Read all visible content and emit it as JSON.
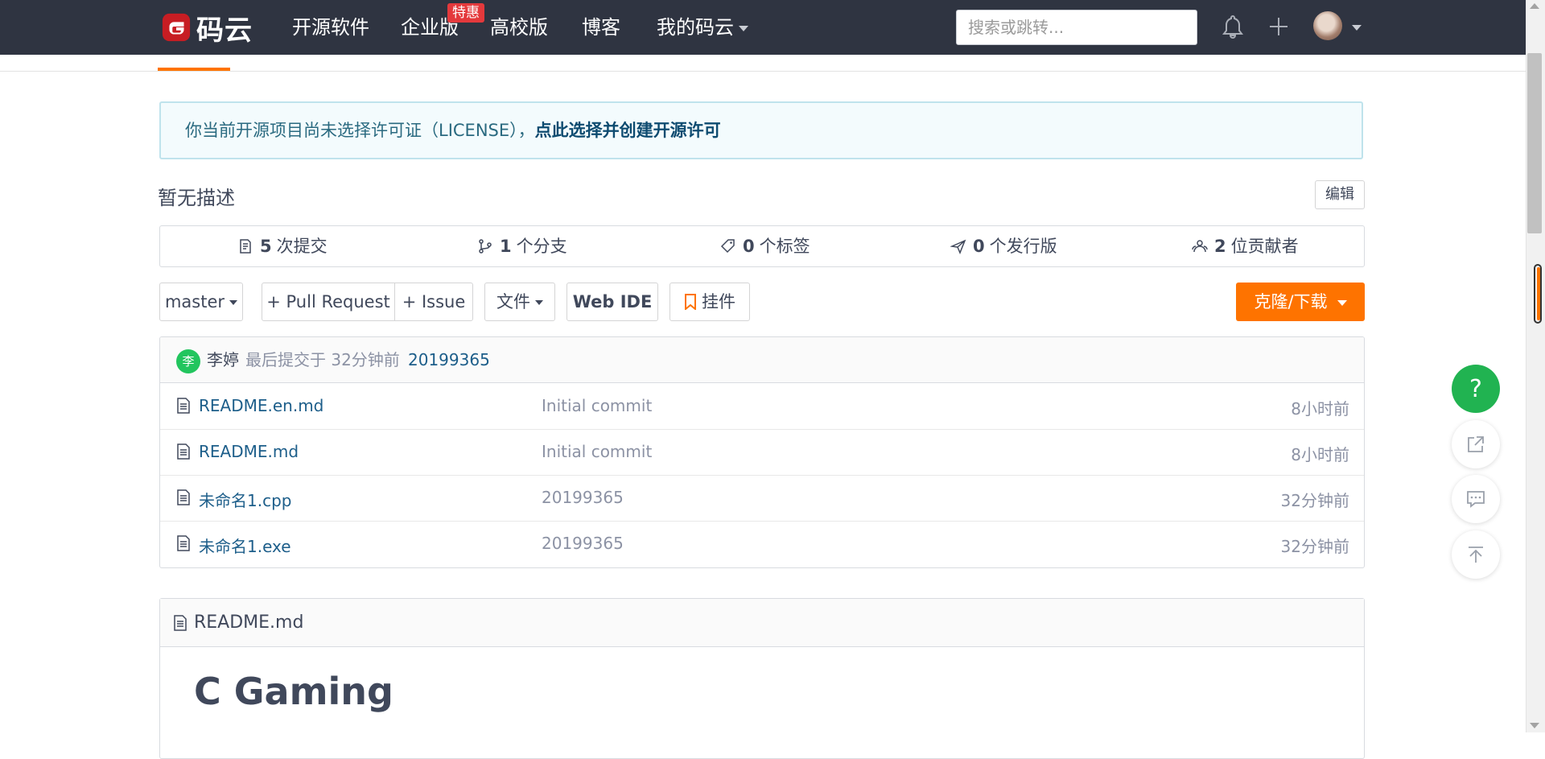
{
  "nav": {
    "logo_text": "码云",
    "items": [
      "开源软件",
      "企业版",
      "高校版",
      "博客"
    ],
    "enterprise_badge": "特惠",
    "my_gitee": "我的码云",
    "search_placeholder": "搜索或跳转..."
  },
  "license": {
    "text": "你当前开源项目尚未选择许可证（LICENSE），",
    "link": "点此选择并创建开源许可"
  },
  "repo": {
    "description": "暂无描述",
    "edit_label": "编辑"
  },
  "stats": [
    {
      "count": "5",
      "label": "次提交"
    },
    {
      "count": "1",
      "label": "个分支"
    },
    {
      "count": "0",
      "label": "个标签"
    },
    {
      "count": "0",
      "label": "个发行版"
    },
    {
      "count": "2",
      "label": "位贡献者"
    }
  ],
  "toolbar": {
    "branch": "master",
    "pull_request": "+ Pull Request",
    "issue": "+ Issue",
    "file": "文件",
    "web_ide": "Web IDE",
    "widget": "挂件",
    "clone": "克隆/下载"
  },
  "last_commit": {
    "avatar_char": "李",
    "author": "李婷",
    "meta": "最后提交于 32分钟前",
    "commit_id": "20199365"
  },
  "files": [
    {
      "name": "README.en.md",
      "message": "Initial commit",
      "time": "8小时前"
    },
    {
      "name": "README.md",
      "message": "Initial commit",
      "time": "8小时前"
    },
    {
      "name": "未命名1.cpp",
      "message": "20199365",
      "time": "32分钟前"
    },
    {
      "name": "未命名1.exe",
      "message": "20199365",
      "time": "32分钟前"
    }
  ],
  "readme": {
    "filename": "README.md",
    "title": "C Gaming"
  },
  "float_buttons": {
    "help": "?"
  },
  "colors": {
    "nav_bg": "#2f3441",
    "accent_orange": "#fe7300",
    "help_green": "#21b351",
    "link_blue": "#1d5e8a",
    "badge_red": "#e4393c"
  }
}
